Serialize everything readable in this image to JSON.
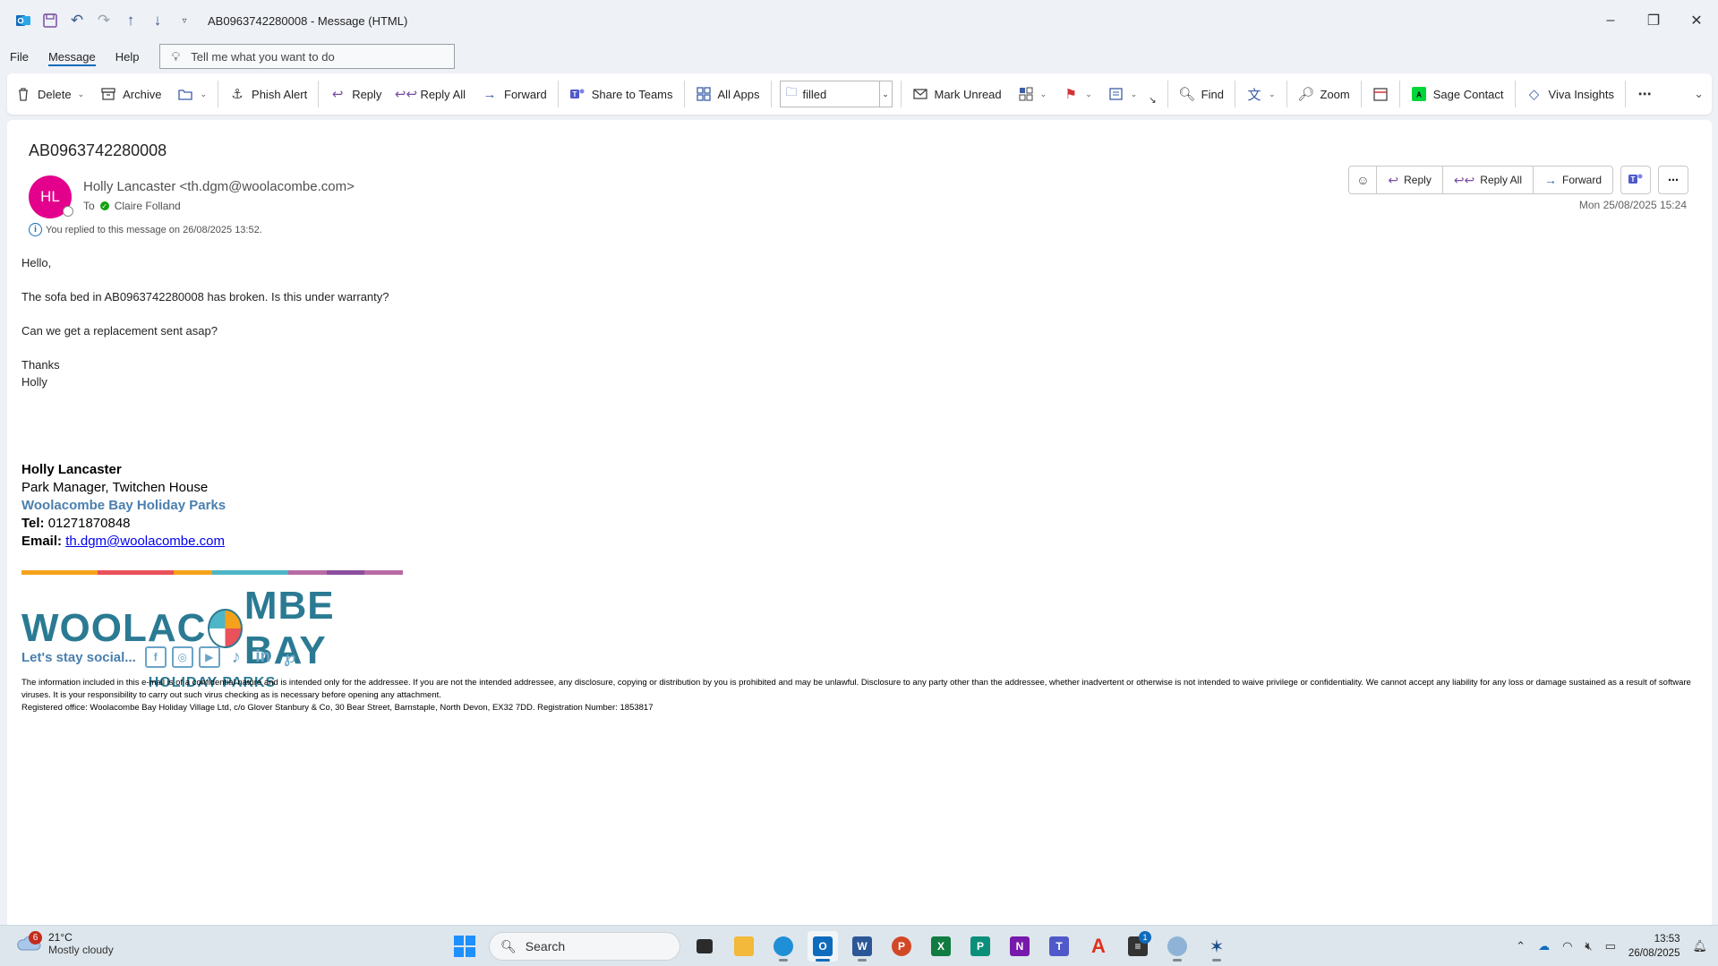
{
  "window": {
    "title": "AB0963742280008  -  Message (HTML)"
  },
  "menu": {
    "items": [
      "File",
      "Message",
      "Help"
    ],
    "tell_me": "Tell me what you want to do"
  },
  "ribbon": {
    "delete": "Delete",
    "archive": "Archive",
    "phish_alert": "Phish Alert",
    "reply": "Reply",
    "reply_all": "Reply All",
    "forward": "Forward",
    "share_to_teams": "Share to Teams",
    "all_apps": "All Apps",
    "folder_value": "filled",
    "mark_unread": "Mark Unread",
    "find": "Find",
    "zoom": "Zoom",
    "sage_contact": "Sage Contact",
    "viva_insights": "Viva Insights"
  },
  "message": {
    "subject": "AB0963742280008",
    "avatar_initials": "HL",
    "sender": "Holly Lancaster <th.dgm@woolacombe.com>",
    "to_label": "To",
    "recipient": "Claire Folland",
    "replied_notice": "You replied to this message on 26/08/2025 13:52.",
    "timestamp": "Mon 25/08/2025 15:24",
    "actions": {
      "reply": "Reply",
      "reply_all": "Reply All",
      "forward": "Forward"
    },
    "body": [
      "Hello,",
      "The sofa bed in AB0963742280008 has broken. Is this under warranty?",
      "Can we get a replacement sent asap?"
    ],
    "closing": "Thanks",
    "closing_name": "Holly"
  },
  "signature": {
    "name": "Holly Lancaster",
    "title": "Park Manager, Twitchen House",
    "company": "Woolacombe Bay Holiday Parks",
    "tel_label": "Tel:",
    "tel": "01271870848",
    "email_label": "Email:",
    "email": "th.dgm@woolacombe.com",
    "logo_left": "WOOLAC",
    "logo_right": "MBE BAY",
    "logo_sub": "HOLIDAY PARKS",
    "social_text": "Let's stay social...",
    "stripe_colors": [
      "#f4a21c",
      "#f4a21c",
      "#e9515b",
      "#e9515b",
      "#f4a21c",
      "#4eb6c7",
      "#4eb6c7",
      "#b86ba6",
      "#8b4f9e",
      "#b86ba6"
    ]
  },
  "disclaimer": {
    "line1": "The information included in this e-mail is of a confidential nature and is intended only for the addressee. If you are not the intended addressee, any disclosure, copying or distribution by you is prohibited and may be unlawful. Disclosure to any party other than the addressee, whether inadvertent or otherwise is not intended to waive privilege or confidentiality. We cannot accept any liability for any loss or damage sustained as a result of software viruses. It is your responsibility to carry out such virus checking as is necessary before opening any attachment.",
    "line2": "Registered office: Woolacombe Bay Holiday Village Ltd, c/o Glover Stanbury & Co, 30 Bear Street, Barnstaple, North Devon, EX32 7DD. Registration Number: 1853817"
  },
  "taskbar": {
    "weather_temp": "21°C",
    "weather_desc": "Mostly cloudy",
    "weather_badge": "6",
    "search": "Search",
    "teams_badge": "1",
    "time": "13:53",
    "date": "26/08/2025"
  }
}
